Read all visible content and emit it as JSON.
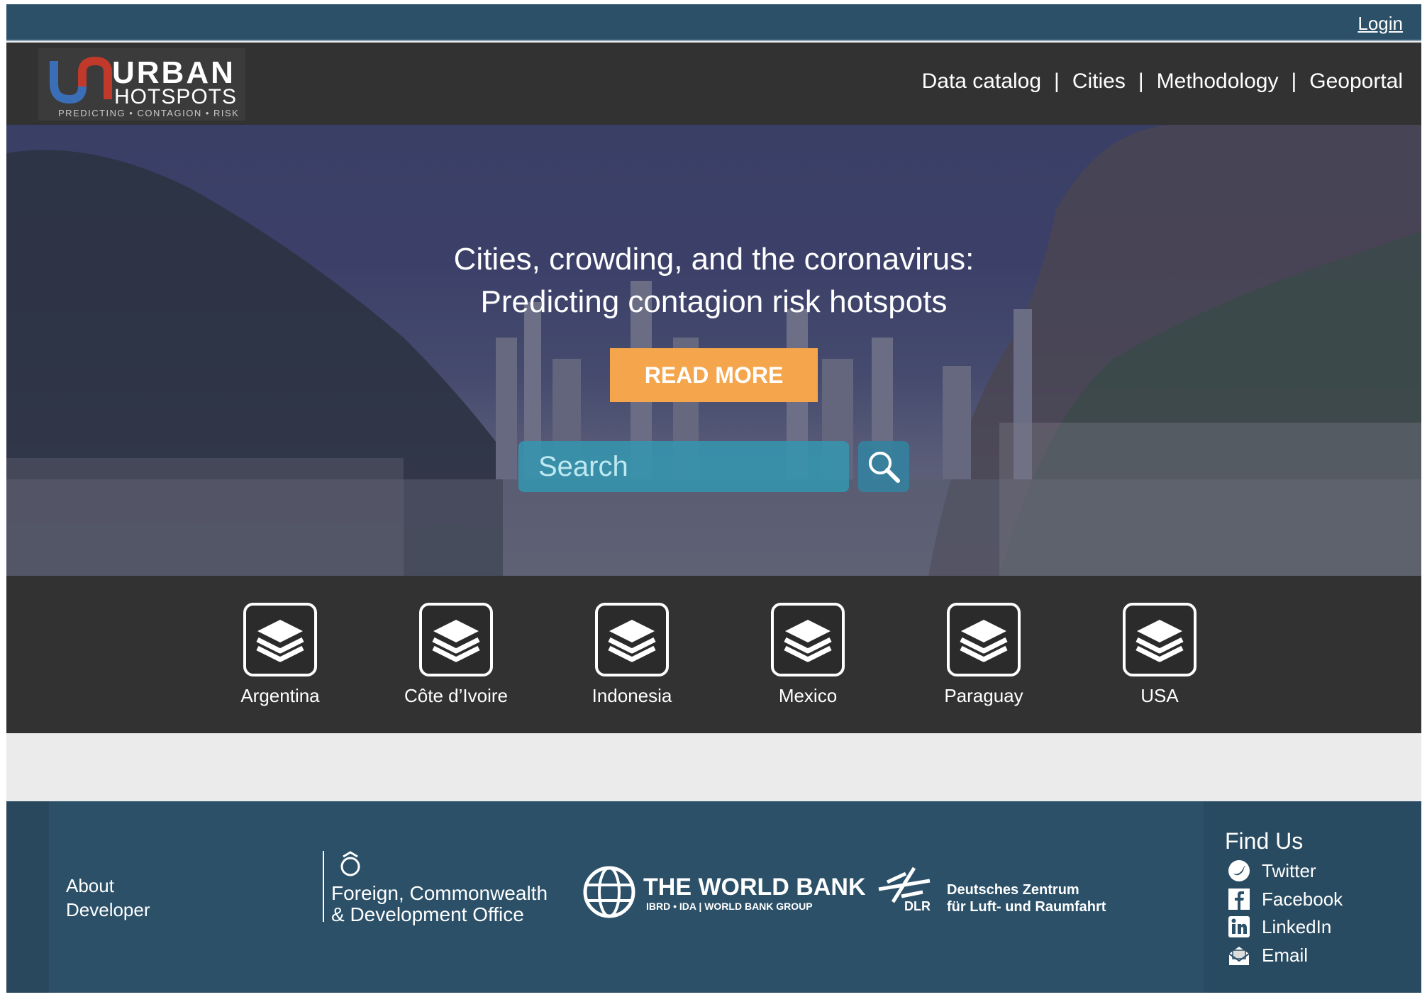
{
  "topbar": {
    "login": "Login"
  },
  "brand": {
    "word1": "URBAN",
    "word2": "HOTSPOTS",
    "tagline": "PREDICTING • CONTAGION • RISK"
  },
  "nav": {
    "items": [
      "Data catalog",
      "Cities",
      "Methodology",
      "Geoportal"
    ],
    "separator": "|"
  },
  "hero": {
    "title_line1": "Cities, crowding, and the coronavirus:",
    "title_line2": "Predicting contagion risk hotspots",
    "cta": "READ MORE",
    "search_placeholder": "Search"
  },
  "countries": [
    "Argentina",
    "Côte d’Ivoire",
    "Indonesia",
    "Mexico",
    "Paraguay",
    "USA"
  ],
  "footer": {
    "links": [
      "About",
      "Developer"
    ],
    "partners": {
      "fcdo_line1": "Foreign, Commonwealth",
      "fcdo_line2": "& Development Office",
      "wb_name": "THE WORLD BANK",
      "wb_sub": "IBRD • IDA | WORLD BANK GROUP",
      "dlr_abbr": "DLR",
      "dlr_line1": "Deutsches Zentrum",
      "dlr_line2": "für Luft- und Raumfahrt"
    },
    "find_us": "Find Us",
    "social": [
      {
        "label": "Twitter",
        "icon": "twitter-icon"
      },
      {
        "label": "Facebook",
        "icon": "facebook-icon"
      },
      {
        "label": "LinkedIn",
        "icon": "linkedin-icon"
      },
      {
        "label": "Email",
        "icon": "email-icon"
      }
    ]
  },
  "colors": {
    "topbar": "#2b5068",
    "header": "#323232",
    "accent": "#f5a54b",
    "search": "#3496b0",
    "footer": "#2b5068"
  }
}
